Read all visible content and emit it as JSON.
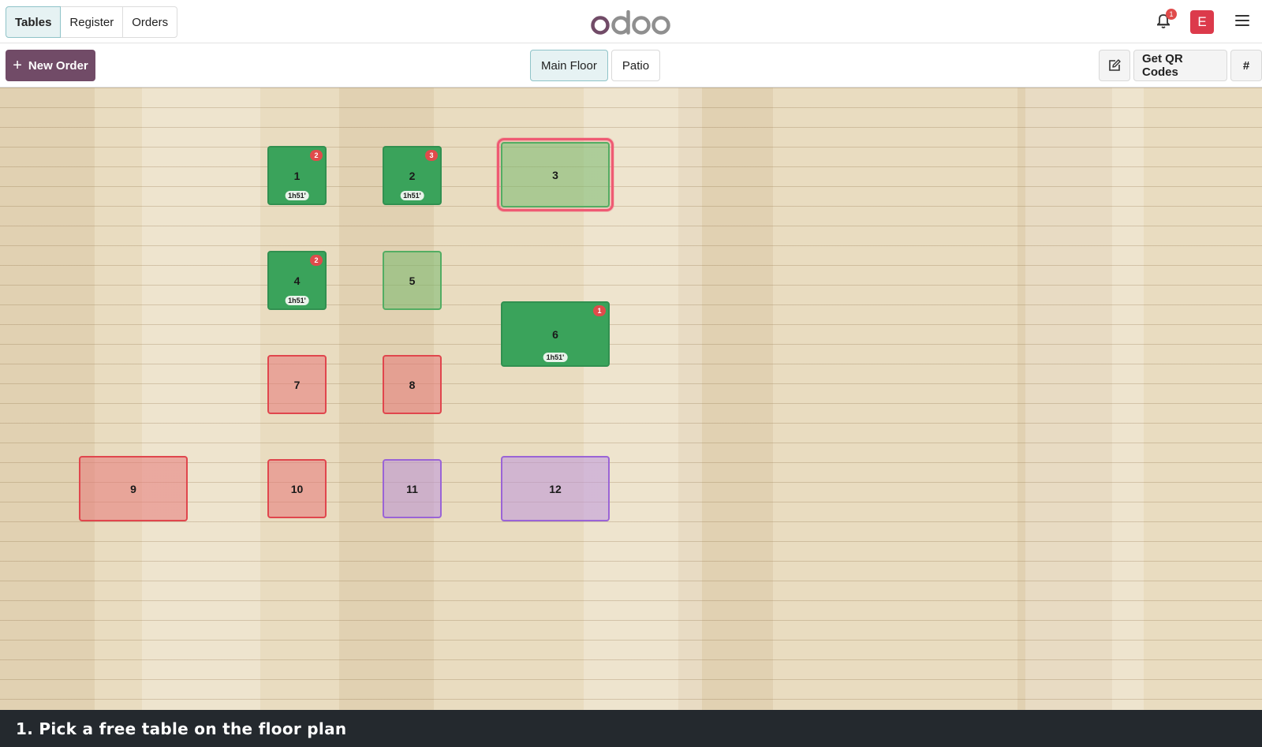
{
  "nav": {
    "tabs": [
      {
        "label": "Tables",
        "active": true
      },
      {
        "label": "Register",
        "active": false
      },
      {
        "label": "Orders",
        "active": false
      }
    ]
  },
  "header": {
    "logo_icon": "odoo-logo",
    "notification_count": "1",
    "avatar_initial": "E",
    "colors": {
      "brand": "#714b67",
      "avatar": "#dc3a4b",
      "badge": "#e04b4b"
    }
  },
  "toolbar": {
    "new_order_label": "New Order",
    "floors": [
      {
        "label": "Main Floor",
        "active": true
      },
      {
        "label": "Patio",
        "active": false
      }
    ],
    "edit_icon": "edit-icon",
    "qr_label": "Get QR Codes",
    "hash_label": "#"
  },
  "tables": [
    {
      "name": "1",
      "state": "occupied",
      "count": "2",
      "time": "1h51'"
    },
    {
      "name": "2",
      "state": "occupied",
      "count": "3",
      "time": "1h51'"
    },
    {
      "name": "3",
      "state": "free",
      "selected": true
    },
    {
      "name": "4",
      "state": "occupied",
      "count": "2",
      "time": "1h51'"
    },
    {
      "name": "5",
      "state": "free"
    },
    {
      "name": "6",
      "state": "occupied",
      "count": "1",
      "time": "1h51'"
    },
    {
      "name": "7",
      "state": "free"
    },
    {
      "name": "8",
      "state": "free"
    },
    {
      "name": "9",
      "state": "free"
    },
    {
      "name": "10",
      "state": "free"
    },
    {
      "name": "11",
      "state": "free"
    },
    {
      "name": "12",
      "state": "free"
    }
  ],
  "tour": {
    "text": "1. Pick a free table on the floor plan"
  }
}
